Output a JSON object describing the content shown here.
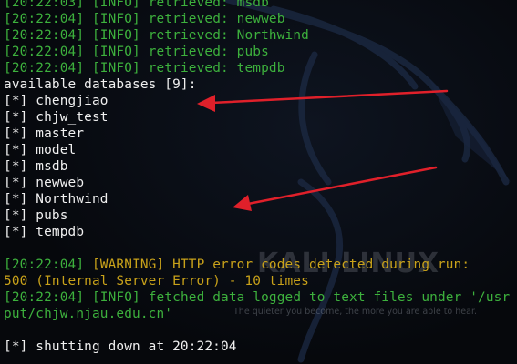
{
  "watermark": {
    "title": "KALI LINUX",
    "tagline": "The quieter you become, the more you are able to hear."
  },
  "terminal": {
    "lines": [
      {
        "time": "[20:22:03]",
        "level": "[INFO]",
        "msg": "retrieved: msdb"
      },
      {
        "time": "[20:22:04]",
        "level": "[INFO]",
        "msg": "retrieved: newweb"
      },
      {
        "time": "[20:22:04]",
        "level": "[INFO]",
        "msg": "retrieved: Northwind"
      },
      {
        "time": "[20:22:04]",
        "level": "[INFO]",
        "msg": "retrieved: pubs"
      },
      {
        "time": "[20:22:04]",
        "level": "[INFO]",
        "msg": "retrieved: tempdb"
      }
    ],
    "available_header": "available databases [9]:",
    "databases": [
      "[*] chengjiao",
      "[*] chjw_test",
      "[*] master",
      "[*] model",
      "[*] msdb",
      "[*] newweb",
      "[*] Northwind",
      "[*] pubs",
      "[*] tempdb"
    ],
    "warning": {
      "time": "[20:22:04]",
      "level": "[WARNING]",
      "msg": "HTTP error codes detected during run:"
    },
    "error_detail": "500 (Internal Server Error) - 10 times",
    "fetched": {
      "time": "[20:22:04]",
      "level": "[INFO]",
      "msg": "fetched data logged to text files under '/usr"
    },
    "fetched_cont": "put/chjw.njau.edu.cn'",
    "shutdown": "[*] shutting down at 20:22:04"
  },
  "colors": {
    "background": "#06080c",
    "time_green": "#3db13d",
    "warning_orange": "#c9a21a",
    "text_white": "#f0f0f0",
    "arrow_red": "#e0202a"
  }
}
